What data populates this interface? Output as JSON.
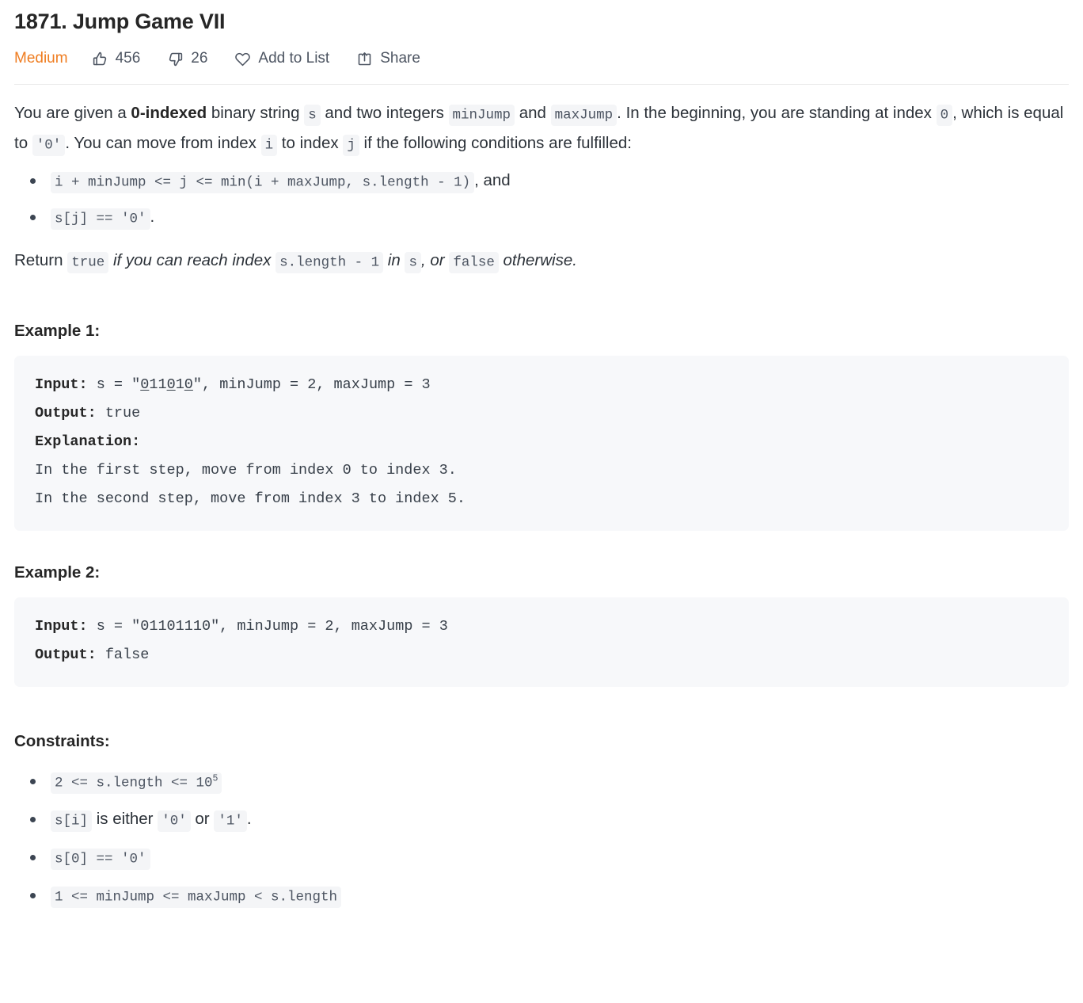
{
  "problem": {
    "title": "1871. Jump Game VII",
    "difficulty": "Medium",
    "difficulty_color": "#ef7d21",
    "likes": "456",
    "dislikes": "26",
    "add_to_list_label": "Add to List",
    "share_label": "Share",
    "icons": {
      "like": "thumbs-up-icon",
      "dislike": "thumbs-down-icon",
      "favorite": "heart-icon",
      "share": "share-icon"
    }
  },
  "description": {
    "p1": {
      "t1": "You are given a ",
      "b1": "0-indexed",
      "t2": " binary string ",
      "c1": "s",
      "t3": " and two integers ",
      "c2": "minJump",
      "t4": " and ",
      "c3": "maxJump",
      "t5": ". In the beginning, you are standing at index ",
      "c4": "0",
      "t6": ", which is equal to ",
      "c5": "'0'",
      "t7": ". You can move from index ",
      "c6": "i",
      "t8": " to index ",
      "c7": "j",
      "t9": " if the following conditions are fulfilled:"
    },
    "conditions": [
      {
        "code": "i + minJump <= j <= min(i + maxJump, s.length - 1)",
        "tail": ", and"
      },
      {
        "code": "s[j] == '0'",
        "tail": "."
      }
    ],
    "return_line": {
      "t1": "Return ",
      "c1": "true",
      "t2": " if you can reach index ",
      "c2": "s.length - 1",
      "t3": " in ",
      "c3": "s",
      "t4": ", or ",
      "c4": "false",
      "t5": " otherwise."
    }
  },
  "examples": [
    {
      "heading": "Example 1:",
      "input_label": "Input:",
      "input_prefix": " s = \"",
      "input_string_parts": [
        {
          "text": "0",
          "underline": true
        },
        {
          "text": "11",
          "underline": false
        },
        {
          "text": "0",
          "underline": true
        },
        {
          "text": "1",
          "underline": false
        },
        {
          "text": "0",
          "underline": true
        }
      ],
      "input_suffix": "\", minJump = 2, maxJump = 3",
      "output_label": "Output:",
      "output_value": " true",
      "explanation_label": "Explanation:",
      "explanation_lines": [
        "In the first step, move from index 0 to index 3.",
        "In the second step, move from index 3 to index 5."
      ]
    },
    {
      "heading": "Example 2:",
      "input_label": "Input:",
      "input_prefix": " s = \"",
      "input_string_parts": [
        {
          "text": "01101110",
          "underline": false
        }
      ],
      "input_suffix": "\", minJump = 2, maxJump = 3",
      "output_label": "Output:",
      "output_value": " false",
      "explanation_label": "",
      "explanation_lines": []
    }
  ],
  "constraints": {
    "heading": "Constraints:",
    "items": [
      {
        "parts": [
          {
            "type": "code",
            "text": "2 <= s.length <= 10",
            "sup": "5"
          }
        ]
      },
      {
        "parts": [
          {
            "type": "code",
            "text": "s[i]"
          },
          {
            "type": "text",
            "text": " is either "
          },
          {
            "type": "code",
            "text": "'0'"
          },
          {
            "type": "text",
            "text": " or "
          },
          {
            "type": "code",
            "text": "'1'"
          },
          {
            "type": "text",
            "text": "."
          }
        ]
      },
      {
        "parts": [
          {
            "type": "code",
            "text": "s[0] == '0'"
          }
        ]
      },
      {
        "parts": [
          {
            "type": "code",
            "text": "1 <= minJump <= maxJump < s.length"
          }
        ]
      }
    ]
  }
}
